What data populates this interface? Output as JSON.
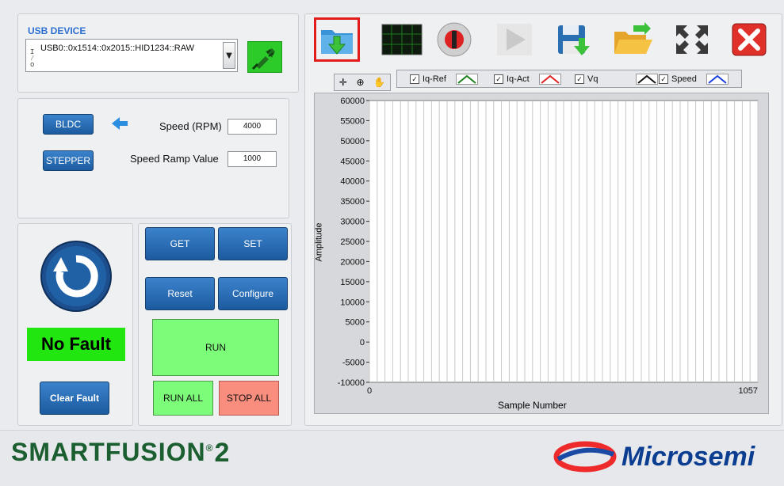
{
  "usb": {
    "title": "USB DEVICE",
    "io_glyph": "I/O",
    "device": "USB0::0x1514::0x2015::HID1234::RAW"
  },
  "motor": {
    "bldc_label": "BLDC",
    "stepper_label": "STEPPER",
    "speed_label": "Speed (RPM)",
    "speed_value": "4000",
    "ramp_label": "Speed Ramp Value",
    "ramp_value": "1000"
  },
  "status": {
    "fault_text": "No Fault",
    "clear_fault_label": "Clear Fault"
  },
  "controls": {
    "get_label": "GET",
    "set_label": "SET",
    "reset_label": "Reset",
    "configure_label": "Configure",
    "run_label": "RUN",
    "run_all_label": "RUN ALL",
    "stop_all_label": "STOP ALL"
  },
  "legend": [
    {
      "name": "Iq-Ref",
      "color": "#1a7f1a"
    },
    {
      "name": "Iq-Act",
      "color": "#e02020"
    },
    {
      "name": "Vq",
      "color": "#111111"
    },
    {
      "name": "Speed",
      "color": "#1a3ee0"
    }
  ],
  "colors": {
    "plot_bg": "#ffffff",
    "grid": "#c8c8c8",
    "accent_blue": "#2c6fd1",
    "selected_outline": "#e21b1b",
    "fault_ok": "#22e60f"
  },
  "chart_data": {
    "type": "line",
    "xlabel": "Sample Number",
    "ylabel": "Amplitude",
    "xlim": [
      0,
      1057
    ],
    "ylim": [
      -10000,
      60000
    ],
    "x_ticks": [
      "0",
      "1057"
    ],
    "y_ticks": [
      "60000",
      "55000",
      "50000",
      "45000",
      "40000",
      "35000",
      "30000",
      "25000",
      "20000",
      "15000",
      "10000",
      "5000",
      "0",
      "-5000",
      "-10000"
    ],
    "grid": true,
    "series": [
      {
        "name": "Iq-Ref",
        "values": []
      },
      {
        "name": "Iq-Act",
        "values": []
      },
      {
        "name": "Vq",
        "values": []
      },
      {
        "name": "Speed",
        "values": []
      }
    ]
  },
  "brand": {
    "smartfusion_left": "SMARTFUSION",
    "smartfusion_num": "2",
    "microsemi": "Microsemi"
  }
}
